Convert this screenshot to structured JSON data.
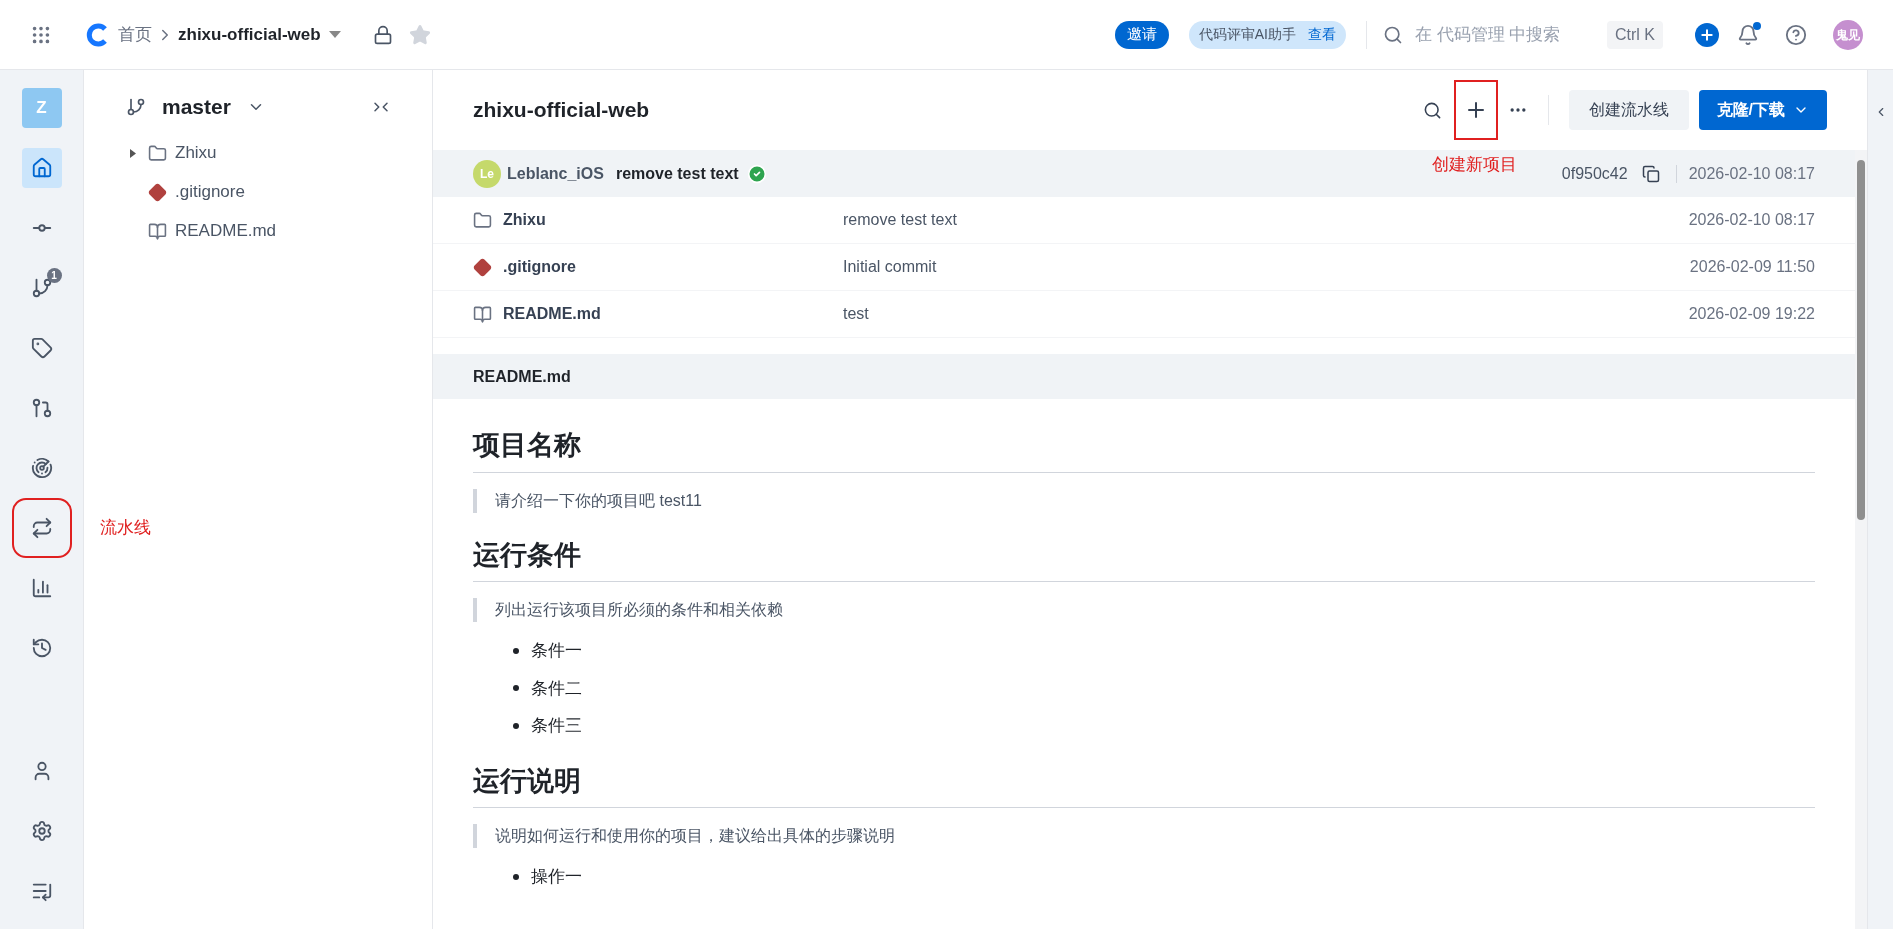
{
  "topbar": {
    "home": "首页",
    "repo": "zhixu-official-web",
    "invite": "邀请",
    "ai_badge": {
      "label": "代码评审AI助手",
      "link": "查看"
    },
    "search": {
      "placeholder": "在 代码管理 中搜索"
    },
    "shortcut": "Ctrl K",
    "has_unread": true,
    "avatar": "鬼见"
  },
  "rail": {
    "project_initial": "Z",
    "items": [
      {
        "kind": "home",
        "selected": true
      },
      {
        "kind": "commits",
        "selected": false
      },
      {
        "kind": "branches",
        "selected": false,
        "badge": "1"
      },
      {
        "kind": "tags",
        "selected": false
      },
      {
        "kind": "merge",
        "selected": false
      },
      {
        "kind": "radar",
        "selected": false
      },
      {
        "kind": "pipeline",
        "selected": false,
        "annotation": "流水线"
      },
      {
        "kind": "stats",
        "selected": false
      },
      {
        "kind": "history",
        "selected": false
      }
    ],
    "bottom": [
      {
        "kind": "member"
      },
      {
        "kind": "settings"
      },
      {
        "kind": "collapse"
      }
    ]
  },
  "tree": {
    "branch": "master",
    "items": [
      {
        "kind": "folder",
        "name": "Zhixu",
        "expanded": false
      },
      {
        "kind": "git",
        "name": ".gitignore"
      },
      {
        "kind": "readme",
        "name": "README.md"
      }
    ]
  },
  "main": {
    "title": "zhixu-official-web",
    "new_annotation": "创建新项目",
    "create_pipeline": "创建流水线",
    "clone": "克隆/下载",
    "commit": {
      "avatar": "Le",
      "author": "Leblanc_iOS",
      "message": "remove test text",
      "ci_passed": true,
      "hash": "0f950c42",
      "time": "2026-02-10 08:17"
    },
    "files": [
      {
        "kind": "folder",
        "name": "Zhixu",
        "message": "remove test text",
        "time": "2026-02-10 08:17"
      },
      {
        "kind": "git",
        "name": ".gitignore",
        "message": "Initial commit",
        "time": "2026-02-09 11:50"
      },
      {
        "kind": "readme",
        "name": "README.md",
        "message": "test",
        "time": "2026-02-09 19:22"
      }
    ],
    "readme": {
      "filename": "README.md",
      "blocks": [
        {
          "kind": "h2",
          "text": "项目名称"
        },
        {
          "kind": "quote",
          "text": "请介绍一下你的项目吧 test11"
        },
        {
          "kind": "h2",
          "text": "运行条件"
        },
        {
          "kind": "quote",
          "text": "列出运行该项目所必须的条件和相关依赖"
        },
        {
          "kind": "list",
          "items": [
            "条件一",
            "条件二",
            "条件三"
          ]
        },
        {
          "kind": "h2",
          "text": "运行说明"
        },
        {
          "kind": "quote",
          "text": "说明如何运行和使用你的项目，建议给出具体的步骤说明"
        },
        {
          "kind": "list",
          "items": [
            "操作一"
          ]
        }
      ]
    }
  }
}
